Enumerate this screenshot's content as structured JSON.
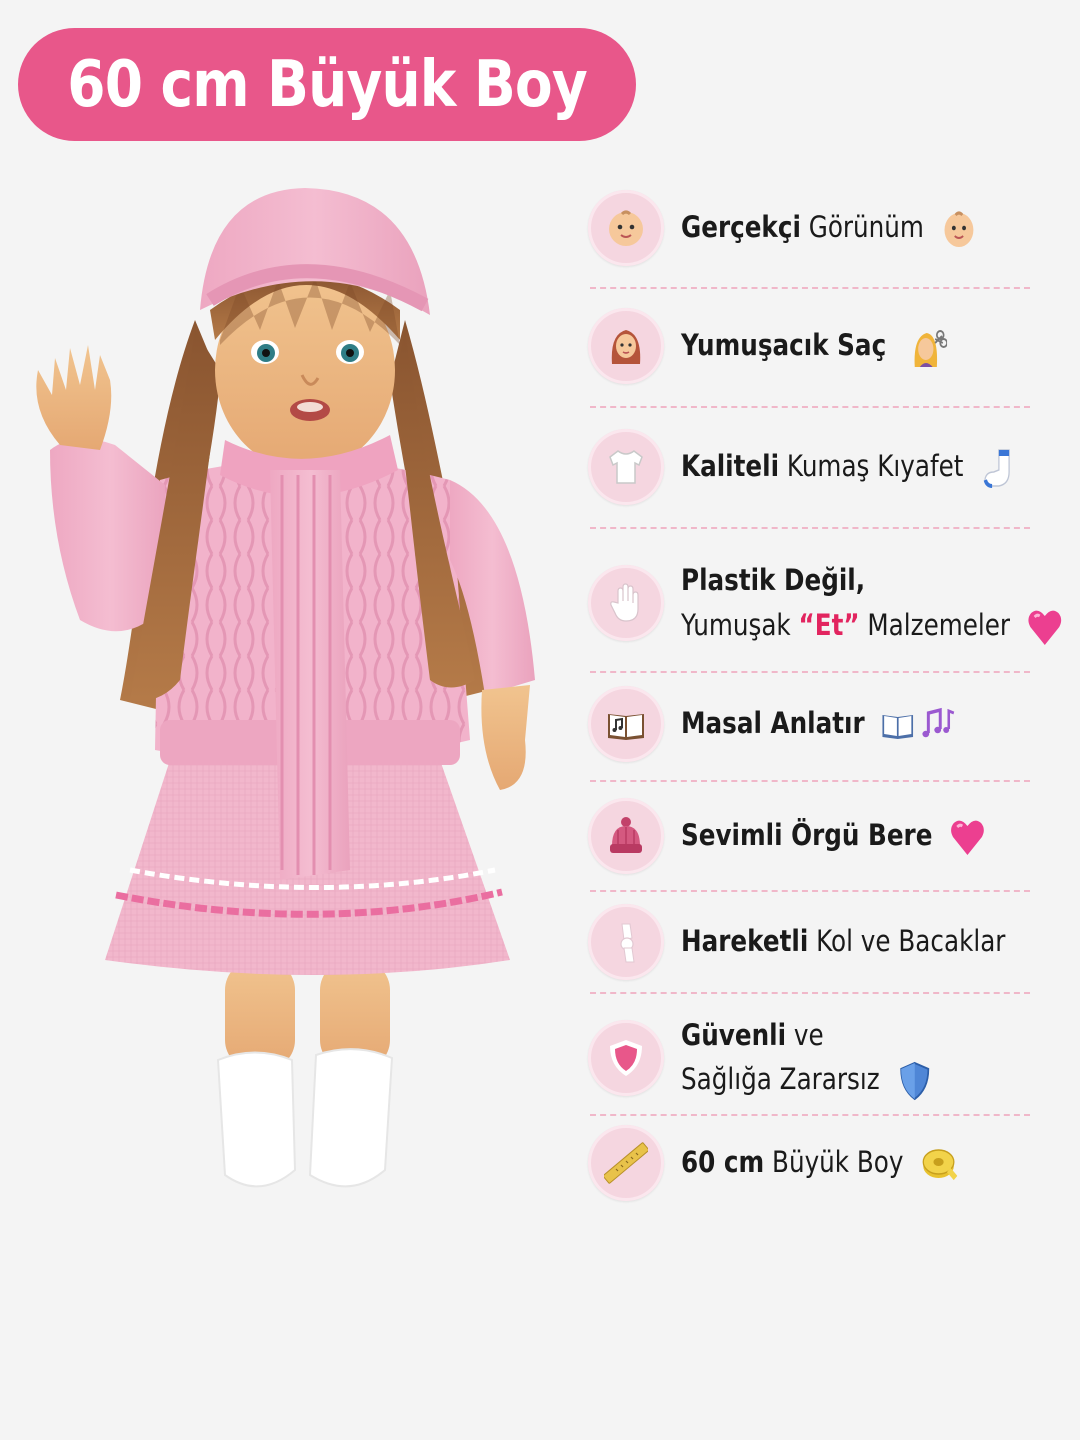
{
  "title": "60 cm Büyük Boy",
  "colors": {
    "accent": "#e8578a",
    "icon_bg": "#f5d6e0",
    "highlight": "#e2245f",
    "divider": "#f0b7c9"
  },
  "features": [
    {
      "bold": "Gerçekçi",
      "rest": " Görünüm",
      "icon": "baby-face-icon",
      "emoji": "baby-emoji-icon"
    },
    {
      "bold": "Yumuşacık Saç",
      "rest": "",
      "icon": "woman-hair-icon",
      "emoji": "haircut-emoji-icon"
    },
    {
      "bold": "Kaliteli",
      "rest": " Kumaş Kıyafet",
      "icon": "tshirt-icon",
      "emoji": "sock-emoji-icon"
    },
    {
      "line1": "Plastik Değil,",
      "line2_pre": "Yumuşak ",
      "line2_pink": "“Et”",
      "line2_post": " Malzemeler",
      "icon": "hand-icon",
      "emoji": "pink-heart-emoji-icon"
    },
    {
      "bold": "Masal Anlatır",
      "rest": "",
      "icon": "storybook-music-icon",
      "emoji": "book-music-emoji-icon"
    },
    {
      "bold": "Sevimli Örgü Bere",
      "rest": "",
      "icon": "knit-hat-icon",
      "emoji": "pink-heart-emoji-icon"
    },
    {
      "bold": "Hareketli",
      "rest": " Kol ve Bacaklar",
      "icon": "joint-arm-icon",
      "emoji": ""
    },
    {
      "line1": "Güvenli",
      "line1_rest": " ve",
      "line2": "Sağlığa Zararsız",
      "icon": "shield-icon",
      "emoji": "blue-shield-emoji-icon"
    },
    {
      "bold": "60 cm",
      "rest": " Büyük Boy",
      "icon": "ruler-icon",
      "emoji": "tape-measure-emoji-icon"
    }
  ]
}
